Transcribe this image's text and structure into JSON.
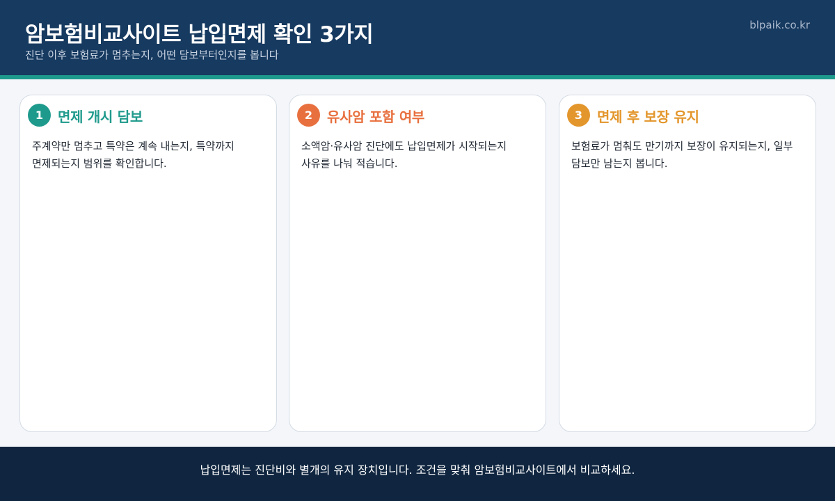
{
  "header": {
    "title": "암보험비교사이트 납입면제 확인 3가지",
    "subtitle": "진단 이후 보험료가 멈추는지, 어떤 담보부터인지를 봅니다",
    "site": "blpaik.co.kr"
  },
  "cards": [
    {
      "number": "1",
      "title": "면제 개시 담보",
      "body": "주계약만 멈추고 특약은 계속 내는지, 특약까지 면제되는지 범위를 확인합니다.",
      "color": "#1e9a8c"
    },
    {
      "number": "2",
      "title": "유사암 포함 여부",
      "body": "소액암·유사암 진단에도 납입면제가 시작되는지 사유를 나눠 적습니다.",
      "color": "#e8703f"
    },
    {
      "number": "3",
      "title": "면제 후 보장 유지",
      "body": "보험료가 멈춰도 만기까지 보장이 유지되는지, 일부 담보만 남는지 봅니다.",
      "color": "#e3962c"
    }
  ],
  "footer": {
    "text": "납입면제는 진단비와 별개의 유지 장치입니다. 조건을 맞춰 암보험비교사이트에서 비교하세요."
  },
  "colors": {
    "header_bg": "#173a60",
    "accent": "#1e9a8c",
    "footer_bg": "#102640",
    "page_bg": "#f4f6fa"
  }
}
